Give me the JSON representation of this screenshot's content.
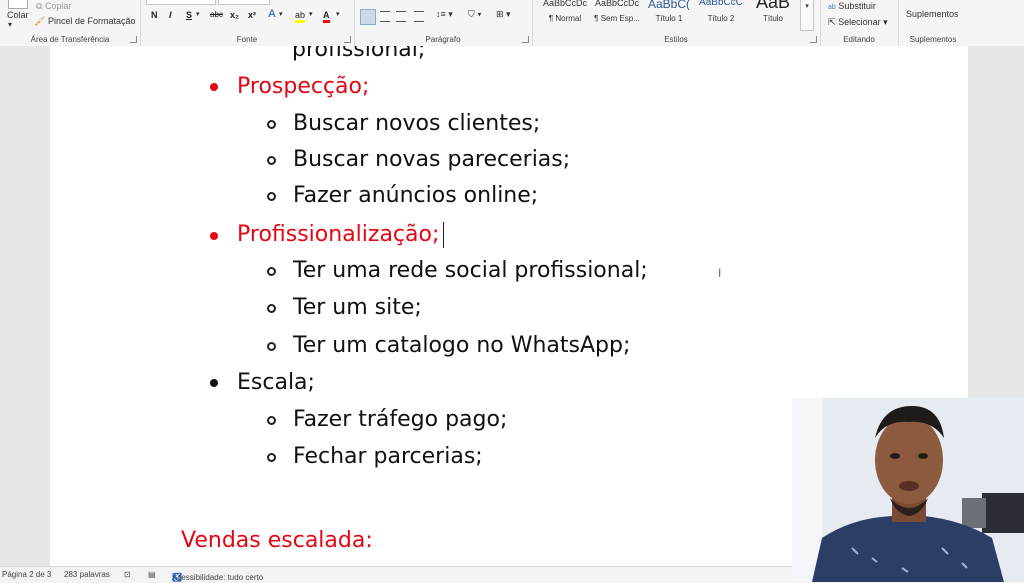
{
  "ribbon": {
    "clipboard": {
      "paste": "Colar",
      "copy": "Copiar",
      "format_painter": "Pincel de Formatação",
      "label": "Área de Transferência"
    },
    "font": {
      "label": "Fonte",
      "buttons": [
        "N",
        "I",
        "S",
        "abc",
        "x₂",
        "x²"
      ]
    },
    "paragraph": {
      "label": "Parágrafo"
    },
    "styles": {
      "label": "Estilos",
      "items": [
        {
          "preview": "AaBbCcDc",
          "name": "¶ Normal"
        },
        {
          "preview": "AaBbCcDc",
          "name": "¶ Sem Esp..."
        },
        {
          "preview": "AaBbC(",
          "name": "Título 1"
        },
        {
          "preview": "AaBbCcC",
          "name": "Título 2"
        },
        {
          "preview": "AaB",
          "name": "Título"
        }
      ]
    },
    "editing": {
      "label": "Editando",
      "replace": "Substituir",
      "select": "Selecionar"
    },
    "addins": {
      "label": "Suplementos",
      "button": "Suplementos"
    }
  },
  "document": {
    "top_partial": "profissional;",
    "items": [
      {
        "level": 1,
        "text": "Prospecção;",
        "color": "#e30613"
      },
      {
        "level": 2,
        "text": "Buscar novos clientes;"
      },
      {
        "level": 2,
        "text": "Buscar novas parecerias;"
      },
      {
        "level": 2,
        "text": "Fazer anúncios online;"
      },
      {
        "level": 1,
        "text": "Profissionalização;",
        "color": "#e30613"
      },
      {
        "level": 2,
        "text": "Ter uma rede social profissional;"
      },
      {
        "level": 2,
        "text": "Ter um site;"
      },
      {
        "level": 2,
        "text": "Ter um catalogo no WhatsApp;"
      },
      {
        "level": 1,
        "text": "Escala;",
        "color": "#111111"
      },
      {
        "level": 2,
        "text": "Fazer tráfego pago;"
      },
      {
        "level": 2,
        "text": "Fechar parcerias;"
      }
    ],
    "heading": "Vendas escalada:",
    "accent_color": "#e30613"
  },
  "status_bar": {
    "page": "Página 2 de 3",
    "words": "283 palavras",
    "accessibility": "Acessibilidade: tudo certo"
  }
}
